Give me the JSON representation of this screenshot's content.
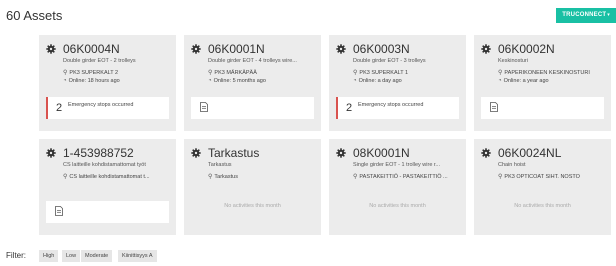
{
  "header": {
    "title": "60 Assets",
    "connect_button": "TRUCONNECT",
    "connect_caret": "▾"
  },
  "assets": [
    {
      "code": "06K0004N",
      "description": "Double girder EOT - 2 trolleys",
      "location": "PK3 SUPERKALT 2",
      "status": "Online: 18 hours ago",
      "activity": {
        "count": "2",
        "text": "Emergency stops occurred"
      }
    },
    {
      "code": "06K0001N",
      "description": "Double girder EOT - 4 trolleys wire...",
      "location": "PK3 MÄRKÄPÄÄ",
      "status": "Online: 5 months ago",
      "activity": {
        "count": "",
        "text": ""
      }
    },
    {
      "code": "06K0003N",
      "description": "Double girder EOT - 3 trolleys",
      "location": "PK3 SUPERKALT 1",
      "status": "Online: a day ago",
      "activity": {
        "count": "2",
        "text": "Emergency stops occurred"
      }
    },
    {
      "code": "06K0002N",
      "description": "Keskinosturi",
      "location": "PAPERIKONEEN KESKINOSTURI",
      "status": "Online: a year ago",
      "activity": {
        "count": "",
        "text": ""
      }
    },
    {
      "code": "1-453988752",
      "description": "CS laitteille kohdistamattomat työt",
      "location": "CS laitteille kohdistamattomat t...",
      "status": "",
      "activity": {
        "count": "",
        "text": ""
      }
    },
    {
      "code": "Tarkastus",
      "description": "Tarkastus",
      "location": "Tarkastus",
      "status": "",
      "activity": {
        "count": "",
        "text": "No activities this month"
      }
    },
    {
      "code": "08K0001N",
      "description": "Single girder EOT - 1 trolley wire r...",
      "location": "PASTAKEITTIÖ - PASTAKEITTIÖ ...",
      "status": "",
      "activity": {
        "count": "",
        "text": "No activities this month"
      }
    },
    {
      "code": "06K0024NL",
      "description": "Chain hoist",
      "location": "PK3 OPTICOAT SIHT. NOSTO",
      "status": "",
      "activity": {
        "count": "",
        "text": "No activities this month"
      }
    }
  ],
  "filter": {
    "label": "Filter:",
    "chips": [
      "High",
      "Low",
      "Moderate",
      "Kiinittisyys A"
    ]
  },
  "colors": {
    "accent": "#19c0a4",
    "alert": "#d9534f",
    "card_bg": "#ececec"
  },
  "icons": {
    "asset": "gear-icon",
    "location": "map-pin-icon",
    "status": "wifi-signal-icon",
    "report": "document-icon"
  }
}
